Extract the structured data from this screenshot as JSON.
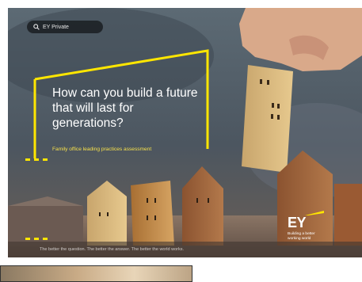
{
  "search": {
    "label": "EY Private"
  },
  "hero": {
    "headline": "How can you build a future that will last for generations?",
    "subline": "Family office leading practices assessment",
    "footer": "The better the question. The better the answer. The better the world works."
  },
  "brand": {
    "logo": "EY",
    "tagline": "Building a better working world",
    "accent": "#ffe600"
  },
  "icons": {
    "search": "search-icon"
  }
}
